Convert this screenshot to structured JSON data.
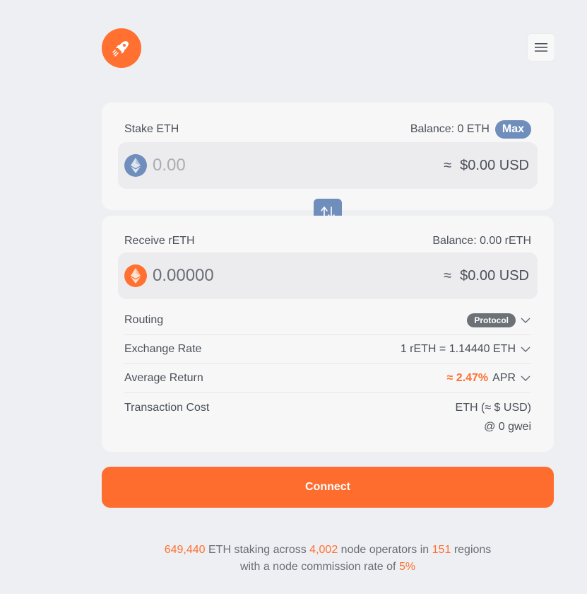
{
  "header": {
    "logo_icon": "rocket-icon",
    "menu_icon": "hamburger-menu-icon"
  },
  "stake": {
    "label": "Stake ETH",
    "balance_label": "Balance: 0 ETH",
    "max_label": "Max",
    "token_icon": "eth-icon",
    "amount_placeholder": "0.00",
    "approx_symbol": "≈",
    "usd_value": "$0.00 USD"
  },
  "swap": {
    "icon": "swap-arrows-icon"
  },
  "receive": {
    "label": "Receive rETH",
    "balance_label": "Balance: 0.00 rETH",
    "token_icon": "reth-icon",
    "amount_value": "0.00000",
    "approx_symbol": "≈",
    "usd_value": "$0.00 USD"
  },
  "details": {
    "routing_label": "Routing",
    "routing_value": "Protocol",
    "exchange_label": "Exchange Rate",
    "exchange_value": "1 rETH = 1.14440 ETH",
    "return_label": "Average Return",
    "return_value": "≈ 2.47%",
    "return_unit": "APR",
    "cost_label": "Transaction Cost",
    "cost_value": "ETH (≈ $ USD)",
    "gas_value": "@ 0 gwei"
  },
  "connect_label": "Connect",
  "footer": {
    "eth_staked": "649,440",
    "text_1": "ETH staking across",
    "node_operators": "4,002",
    "text_2": "node operators in",
    "regions": "151",
    "text_3": "regions",
    "text_4": "with a node commission rate of",
    "commission": "5%"
  },
  "colors": {
    "accent": "#ff7031",
    "primary_blue": "#6f8ebc",
    "background": "#eeeff2"
  }
}
